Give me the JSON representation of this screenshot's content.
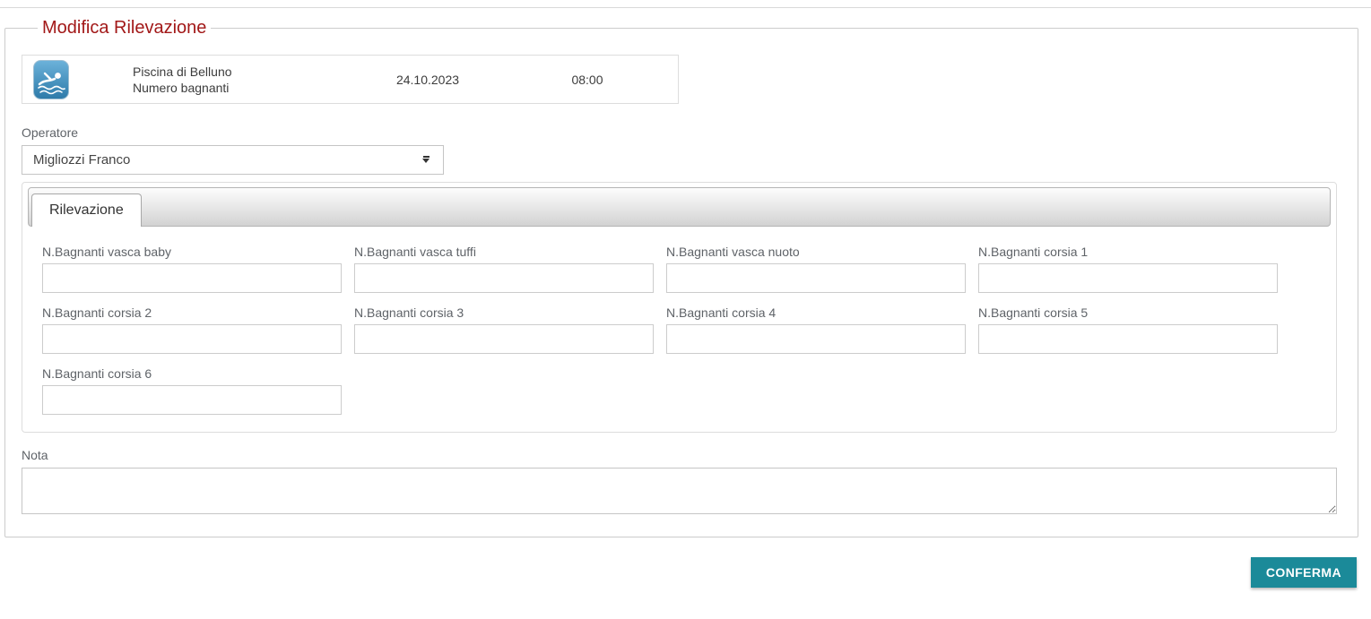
{
  "page": {
    "legend": "Modifica Rilevazione"
  },
  "header_card": {
    "icon": "swimmer-icon",
    "title_line1": "Piscina di Belluno",
    "title_line2": "Numero bagnanti",
    "date": "24.10.2023",
    "time": "08:00"
  },
  "operator": {
    "label": "Operatore",
    "selected": "Migliozzi Franco"
  },
  "tabs": {
    "active_label": "Rilevazione"
  },
  "fields": [
    {
      "label": "N.Bagnanti vasca baby",
      "value": ""
    },
    {
      "label": "N.Bagnanti vasca tuffi",
      "value": ""
    },
    {
      "label": "N.Bagnanti vasca nuoto",
      "value": ""
    },
    {
      "label": "N.Bagnanti corsia 1",
      "value": ""
    },
    {
      "label": "N.Bagnanti corsia 2",
      "value": ""
    },
    {
      "label": "N.Bagnanti corsia 3",
      "value": ""
    },
    {
      "label": "N.Bagnanti corsia 4",
      "value": ""
    },
    {
      "label": "N.Bagnanti corsia 5",
      "value": ""
    },
    {
      "label": "N.Bagnanti corsia 6",
      "value": ""
    }
  ],
  "note": {
    "label": "Nota",
    "value": ""
  },
  "actions": {
    "confirm_label": "CONFERMA"
  },
  "colors": {
    "accent_teal": "#1b8a99",
    "legend_red": "#a21818"
  }
}
